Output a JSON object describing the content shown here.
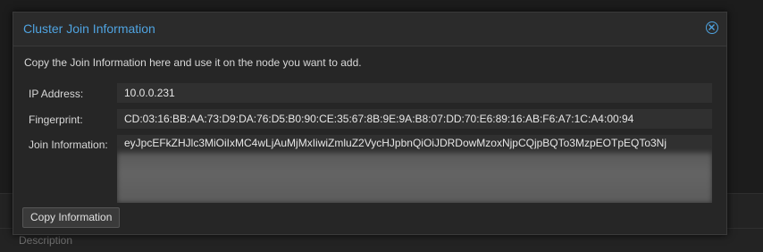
{
  "background": {
    "description_label": "Description"
  },
  "dialog": {
    "title": "Cluster Join Information",
    "close_icon": "close-circle-icon",
    "intro": "Copy the Join Information here and use it on the node you want to add.",
    "fields": {
      "ip_address": {
        "label": "IP Address:",
        "value": "10.0.0.231"
      },
      "fingerprint": {
        "label": "Fingerprint:",
        "value": "CD:03:16:BB:AA:73:D9:DA:76:D5:B0:90:CE:35:67:8B:9E:9A:B8:07:DD:70:E6:89:16:AB:F6:A7:1C:A4:00:94"
      },
      "join_information": {
        "label": "Join Information:",
        "value": "eyJpcEFkZHJlc3MiOiIxMC4wLjAuMjMxIiwiZmluZ2VycHJpbnQiOiJDRDowMzoxNjpCQjpBQTo3MzpEOTpEQTo3Nj"
      }
    },
    "copy_button_label": "Copy Information"
  },
  "colors": {
    "accent": "#4fa3e0",
    "dialog_bg": "#262626",
    "field_bg": "#303030"
  }
}
